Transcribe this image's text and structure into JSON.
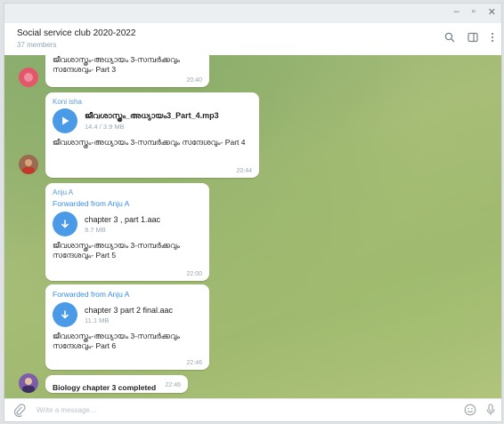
{
  "window": {
    "controls": {
      "minimize": "–",
      "maximize": "▫",
      "close": "✕"
    }
  },
  "header": {
    "title": "Social service club 2020-2022",
    "subtitle": "37 members"
  },
  "messages": [
    {
      "caption": "ജീവശാസ്ത്രം-അധ്യായം 3-സമ്പർക്കവും സന്ദേശവും- Part 3",
      "time": "20:40"
    },
    {
      "sender": "Koni isha",
      "file_name": "ജീവശാസ്ത്രം_അധ്യായം3_Part_4.mp3",
      "file_size": "14.4 / 3.9 MB",
      "caption": "ജീവശാസ്ത്രം-അധ്യായം 3-സമ്പർക്കവും സന്ദേശവും- Part 4",
      "time": "20:44"
    },
    {
      "sender": "Anju A",
      "forwarded": "Forwarded from Anju A",
      "file_name": "chapter 3 , part 1.aac",
      "file_size": "9.7 MB",
      "caption": "ജീവശാസ്ത്രം-അധ്യായം 3-സമ്പർക്കവും സന്ദേശവും- Part 5",
      "time": "22:00"
    },
    {
      "forwarded": "Forwarded from Anju A",
      "file_name": "chapter 3 part 2 final.aac",
      "file_size": "11.1 MB",
      "caption": "ജീവശാസ്ത്രം-അധ്യായം 3-സമ്പർക്കവും സന്ദേശവും- Part 6",
      "time": "22:46"
    },
    {
      "text": "Biology chapter 3 completed",
      "time": "22:46"
    }
  ],
  "input": {
    "placeholder": "Write a message..."
  }
}
